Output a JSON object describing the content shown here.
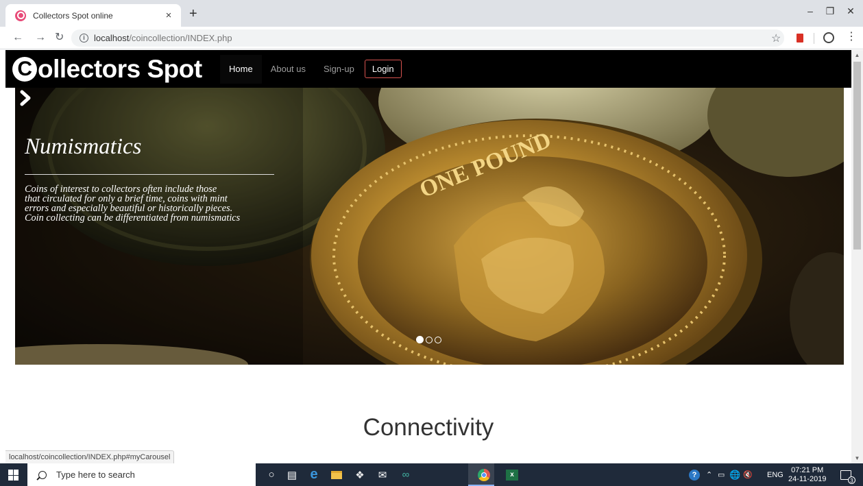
{
  "browser": {
    "tab_title": "Collectors Spot online",
    "tab_close": "×",
    "new_tab": "+",
    "url_host": "localhost",
    "url_path": "/coincollection/INDEX.php",
    "status_url": "localhost/coincollection/INDEX.php#myCarousel"
  },
  "site": {
    "brand_initial": "C",
    "brand_rest": "ollectors Spot",
    "nav": {
      "home": "Home",
      "about": "About us",
      "signup": "Sign-up",
      "login": "Login"
    }
  },
  "carousel": {
    "title": "Numismatics",
    "text_lines": [
      "Coins of interest to collectors often include those",
      "that circulated for only a brief time, coins with mint",
      "errors and especially beautiful or historically pieces.",
      "Coin collecting can be differentiated from numismatics"
    ],
    "coin_legend": "ONE POUND",
    "active_slide": 1,
    "slide_count": 3
  },
  "section": {
    "heading": "Connectivity"
  },
  "taskbar": {
    "search_placeholder": "Type here to search",
    "language": "ENG",
    "time": "07:21 PM",
    "date": "24-11-2019",
    "notification_count": "3"
  },
  "colors": {
    "navbar_bg": "#000000",
    "login_border": "#d9534f",
    "taskbar_bg": "#1f2a3a",
    "coin_gold": "#b8892e"
  }
}
